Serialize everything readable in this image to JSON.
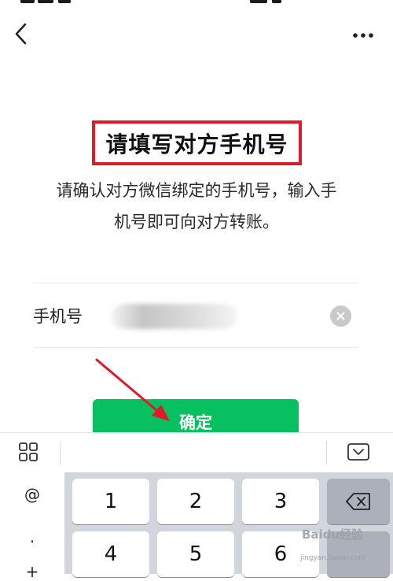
{
  "nav": {
    "back_icon": "chevron-left-icon",
    "more_icon": "more-dots-icon"
  },
  "page": {
    "title": "请填写对方手机号",
    "description_line1": "请确认对方微信绑定的手机号，输入手",
    "description_line2": "机号即可向对方转账。"
  },
  "form": {
    "phone_label": "手机号",
    "phone_value": "",
    "clear_icon": "clear-icon"
  },
  "confirm": {
    "label": "确定"
  },
  "keyboard": {
    "symbols": [
      "@",
      ".",
      "+"
    ],
    "keys_row1": [
      "1",
      "2",
      "3"
    ],
    "keys_row2": [
      "4",
      "5",
      "6"
    ],
    "toolbar_left_icon": "grid-icon",
    "toolbar_right_icon": "keyboard-dismiss-icon",
    "backspace_icon": "backspace-icon"
  },
  "watermark": {
    "text": "Baidu经验",
    "url": "jingyan.baidu.com"
  },
  "colors": {
    "accent": "#07c160",
    "highlight": "#e01a28"
  }
}
